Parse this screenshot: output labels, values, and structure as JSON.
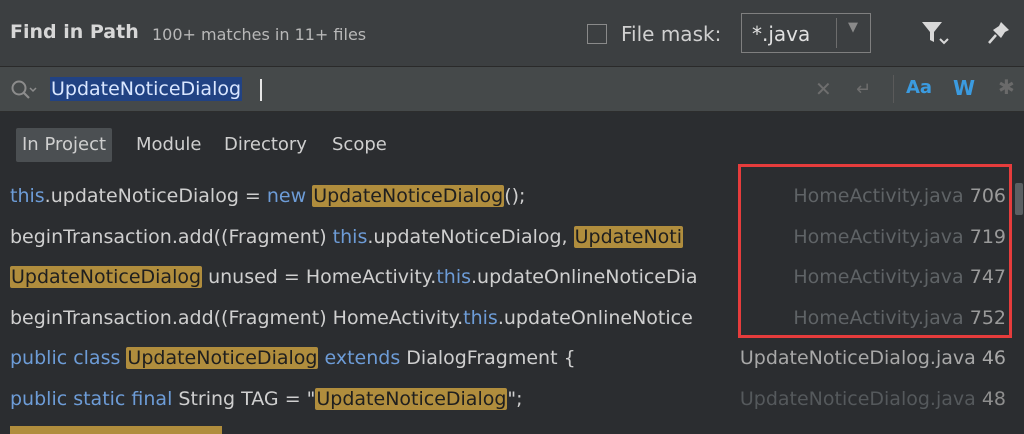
{
  "header": {
    "title": "Find in Path",
    "subtitle": "100+ matches in 11+ files",
    "file_mask_label": "File mask:",
    "file_mask_value": "*.java",
    "icons": [
      "filter-icon",
      "pin-icon"
    ]
  },
  "search": {
    "query": "UpdateNoticeDialog",
    "case_label": "Aa",
    "words_label": "W",
    "icons": [
      "search-icon",
      "clear-icon",
      "wrap-icon",
      "regex-icon"
    ]
  },
  "tabs": [
    {
      "label": "In Project",
      "active": true
    },
    {
      "label": "Module",
      "active": false
    },
    {
      "label": "Directory",
      "active": false
    },
    {
      "label": "Scope",
      "active": false
    }
  ],
  "results": [
    {
      "segments": [
        {
          "text": "this",
          "kind": "kw"
        },
        {
          "text": ".updateNoticeDialog = ",
          "kind": "plain"
        },
        {
          "text": "new ",
          "kind": "kw"
        },
        {
          "text": "UpdateNoticeDialog",
          "kind": "hl"
        },
        {
          "text": "();",
          "kind": "plain"
        }
      ],
      "file": "HomeActivity.java",
      "line": "706"
    },
    {
      "segments": [
        {
          "text": "beginTransaction.add((Fragment) ",
          "kind": "plain"
        },
        {
          "text": "this",
          "kind": "kw"
        },
        {
          "text": ".updateNoticeDialog, ",
          "kind": "plain"
        },
        {
          "text": "UpdateNoti",
          "kind": "hl"
        }
      ],
      "file": "HomeActivity.java",
      "line": "719"
    },
    {
      "segments": [
        {
          "text": "UpdateNoticeDialog",
          "kind": "hl"
        },
        {
          "text": " unused = HomeActivity.",
          "kind": "plain"
        },
        {
          "text": "this",
          "kind": "kw"
        },
        {
          "text": ".updateOnlineNoticeDia",
          "kind": "plain"
        }
      ],
      "file": "HomeActivity.java",
      "line": "747"
    },
    {
      "segments": [
        {
          "text": "beginTransaction.add((Fragment) HomeActivity.",
          "kind": "plain"
        },
        {
          "text": "this",
          "kind": "kw"
        },
        {
          "text": ".updateOnlineNotice",
          "kind": "plain"
        }
      ],
      "file": "HomeActivity.java",
      "line": "752"
    },
    {
      "segments": [
        {
          "text": "public class ",
          "kind": "kw"
        },
        {
          "text": "UpdateNoticeDialog",
          "kind": "hl"
        },
        {
          "text": " extends ",
          "kind": "kw"
        },
        {
          "text": "DialogFragment {",
          "kind": "plain"
        }
      ],
      "file": "UpdateNoticeDialog.java",
      "line": "46",
      "style": "bright"
    },
    {
      "segments": [
        {
          "text": "public static final ",
          "kind": "kw"
        },
        {
          "text": "String TAG = \"",
          "kind": "plain"
        },
        {
          "text": "UpdateNoticeDialog",
          "kind": "hl"
        },
        {
          "text": "\";",
          "kind": "plain"
        }
      ],
      "file": "UpdateNoticeDialog.java",
      "line": "48",
      "style": "dim"
    }
  ],
  "colors": {
    "highlight": "#b08d3d",
    "keyword": "#6d9cd7",
    "selection": "#214283",
    "annotation_box": "#e63c3c"
  }
}
